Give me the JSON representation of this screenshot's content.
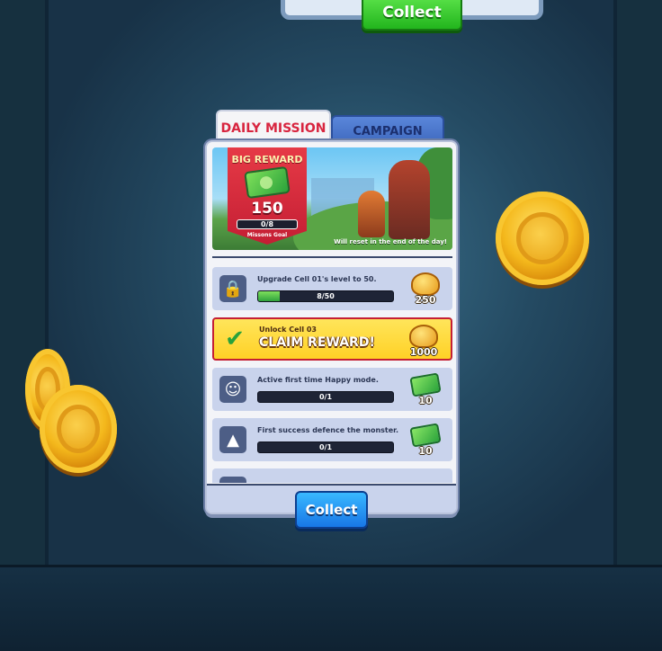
{
  "top_collect_label": "Collect",
  "tabs": {
    "daily": "DAILY MISSION",
    "campaign": "CAMPAIGN"
  },
  "big_reward": {
    "title": "BIG REWARD",
    "value": "150",
    "progress_text": "0/8",
    "goal_label": "Missons Goal",
    "reset_note": "Will reset in the end of the day!"
  },
  "missions": [
    {
      "text": "Upgrade Cell 01's level to 50.",
      "progress_text": "8/50",
      "progress_fraction": 0.16,
      "reward": "250",
      "reward_type": "coins",
      "icon": "lock-icon"
    },
    {
      "sub": "Unlock Cell 03",
      "claim_label": "CLAIM REWARD!",
      "reward": "1000",
      "reward_type": "coins",
      "icon": "check-icon"
    },
    {
      "text": "Active first time Happy mode.",
      "progress_text": "0/1",
      "progress_fraction": 0,
      "reward": "10",
      "reward_type": "cash",
      "icon": "happy-face-icon"
    },
    {
      "text": "First success defence the monster.",
      "progress_text": "0/1",
      "progress_fraction": 0,
      "reward": "10",
      "reward_type": "cash",
      "icon": "monster-icon"
    }
  ],
  "collect_label": "Collect",
  "colors": {
    "accent_red": "#d8253f",
    "claim_yellow": "#ffd126",
    "collect_blue": "#1877e6",
    "progress_green": "#2fa23d"
  }
}
